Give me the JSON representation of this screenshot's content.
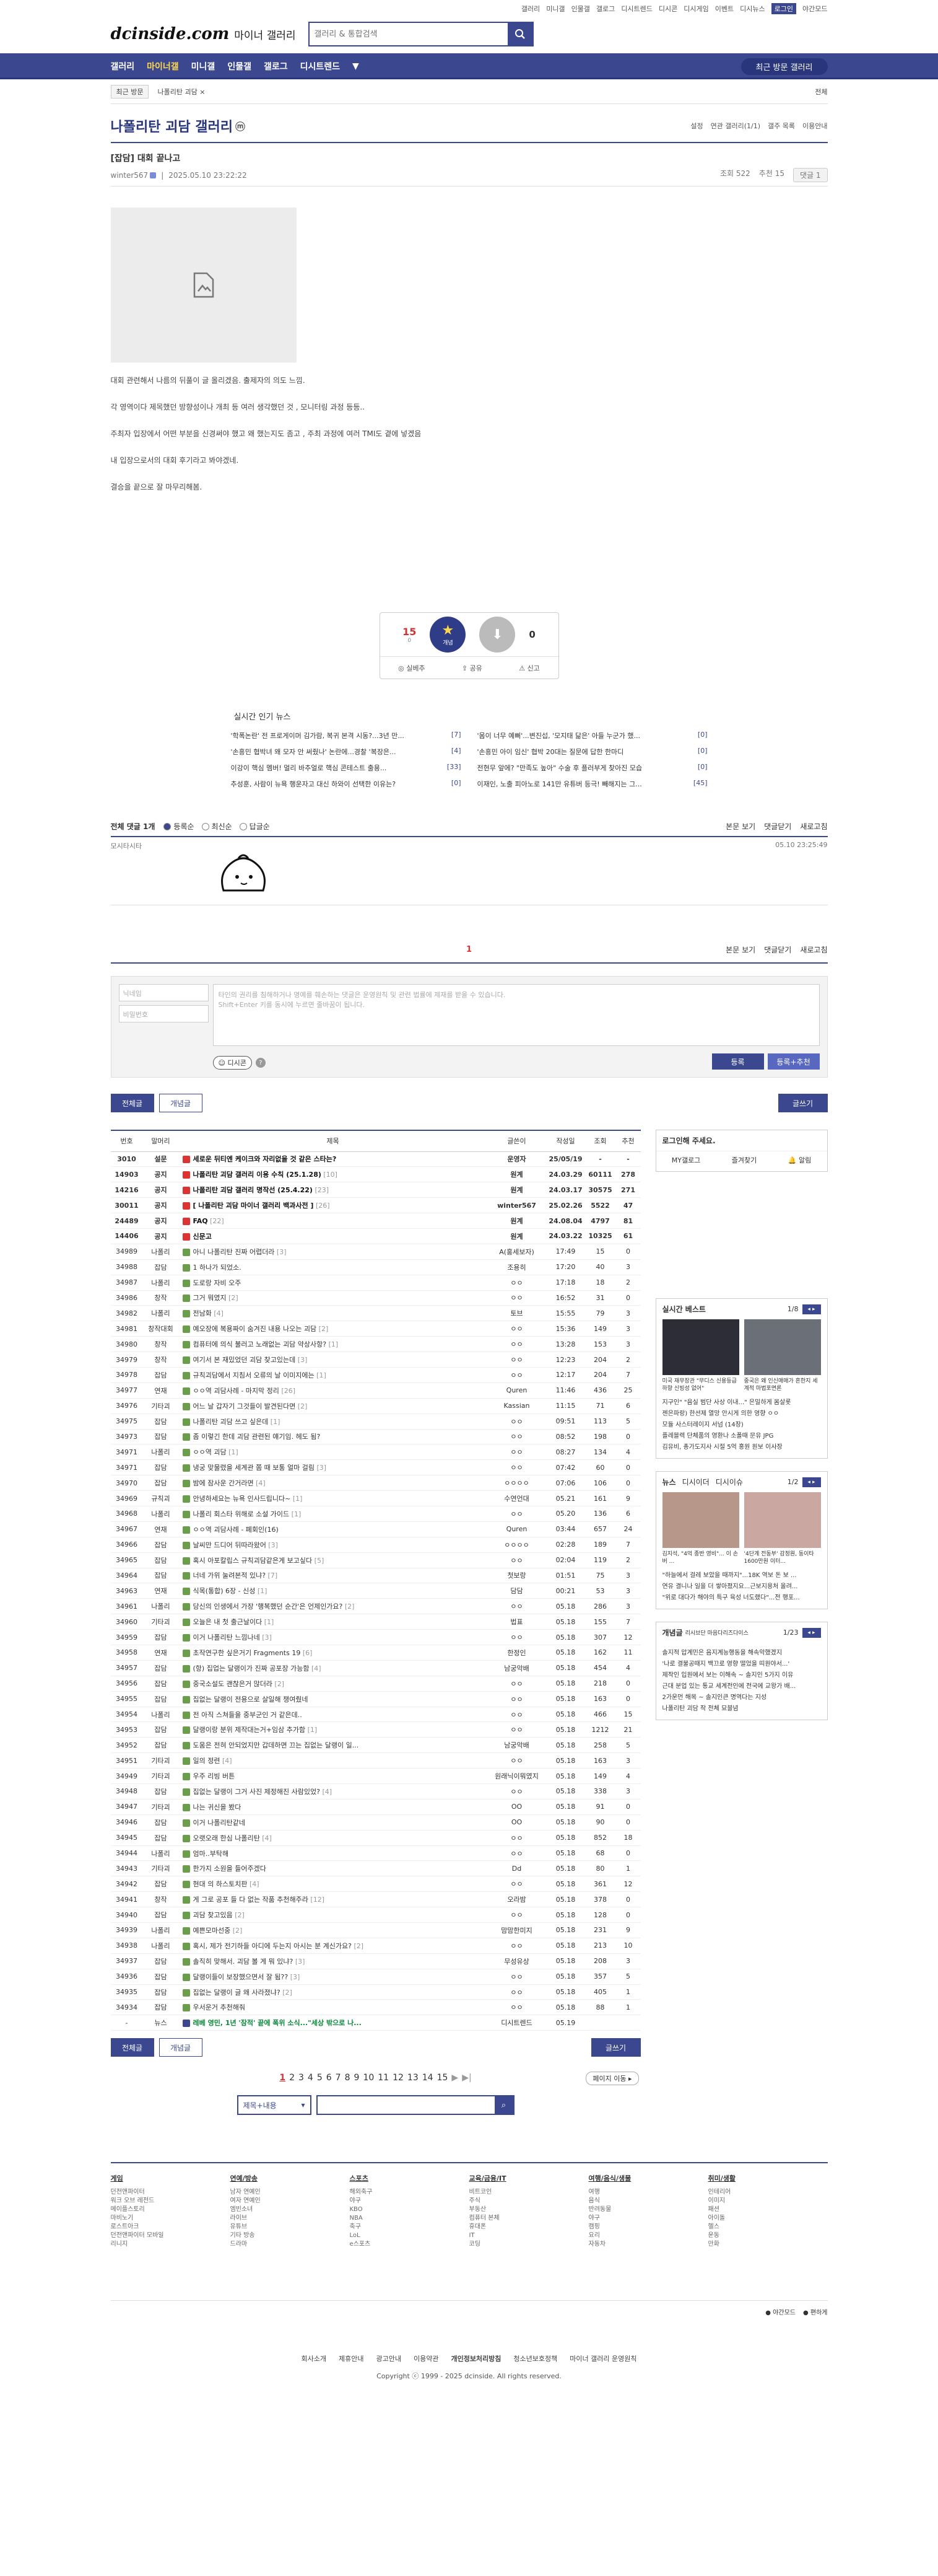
{
  "util_links": [
    "갤러리",
    "미니갤",
    "인물갤",
    "갤로그",
    "디시트렌드",
    "디시콘",
    "디시게임",
    "이벤트",
    "디시뉴스",
    "로그인",
    "야간모드"
  ],
  "logo": "dcinside.com",
  "logo_sub": "마이너 갤러리",
  "search_placeholder": "갤러리 & 통합검색",
  "gnb": [
    "갤러리",
    "마이너갤",
    "미니갤",
    "인물갤",
    "갤로그",
    "디시트렌드"
  ],
  "recent_btn": "최근 방문 갤러리",
  "sub": {
    "recent": "최근 방문",
    "path": "나폴리탄 괴담 ×",
    "all": "전체"
  },
  "gallery_title": "나폴리탄 괴담 갤러리",
  "gallery_badge": "ⓜ",
  "gallery_opts": [
    "설정",
    "연관 갤러리(1/1)",
    "갤주 목록",
    "이용안내"
  ],
  "post": {
    "title": "[잡담] 대회 끝나고",
    "author": "winter567",
    "time": "2025.05.10 23:22:22",
    "views": "조회 522",
    "rec": "추천 15",
    "comment": "댓글 1"
  },
  "body": [
    "대회 관련해서 나름의 뒤풀이 글 올리겠음. 출제자의 의도 느낌.",
    "각 영역이다 제목했던 방향성이나 개최 등 여러 생각했던 것 , 모니터링 과정 등등..",
    "주최자 입장에서 어떤 부분을 신경써야 했고 왜 했는지도 좀고 , 주최 과정에 여러 TMI도 곁에 넣겠음",
    "내 입장으로서의 대회 후기라고 봐야겠네.",
    "결승을 끝으로 잘 마무리해봄."
  ],
  "recommend": {
    "up": "15",
    "fix": "0",
    "down": "0",
    "up_label": "개념",
    "share": "공유",
    "report": "신고",
    "sub": "실베추"
  },
  "hot_news_title": "실시간 인기 뉴스",
  "hot_news": [
    {
      "t": "'학폭논란' 전 프로게이머 김가람, 복귀 본격 시동?...3년 만...",
      "c": "7"
    },
    {
      "t": "'몸이 너무 예뻐'...변진섭, '모지태 닮은' 아들 누군가 했...",
      "c": "0"
    },
    {
      "t": "'손흥민 협박녀 왜 모자 안 써줬나' 논란에...경찰 '복장은...",
      "c": "4"
    },
    {
      "t": "'손흥민 아이 임신' 협박 20대는 질문에 답한 한마디",
      "c": "0"
    },
    {
      "t": "이강이 핵심 멤버! 멀리 바추얼로 핵심 콘테스트 출용...",
      "c": "33"
    },
    {
      "t": "전현무 앞에? \"만족도 높아\" 수술 후 플러부게 찾아진 모습",
      "c": "0"
    },
    {
      "t": "추성훈, 사람이 뉴욕 행운자고 대신 하와이 선택한 이유는?",
      "c": "0"
    },
    {
      "t": "이재인, 노출 피아노로 141만 유튜버 등극! 빼해지는 그...",
      "c": "45"
    }
  ],
  "cmt_bar": {
    "total": "전체 댓글 1개",
    "sort1": "등록순",
    "sort2": "최신순",
    "sort3": "답글순",
    "view": "본문 보기",
    "close": "댓글닫기",
    "refresh": "새로고침"
  },
  "comment": {
    "nick": "모시타시타",
    "date": "05.10 23:25:49"
  },
  "cmt_page": "1",
  "write": {
    "nick_ph": "닉네임",
    "pw_ph": "비밀번호",
    "txt": "타인의 권리를 침해하거나 명예를 훼손하는 댓글은 운영원칙 및 관련 법률에 제재를 받을 수 있습니다.\nShift+Enter 키를 동시에 누르면 줄바꿈이 됩니다.",
    "dccon": "디시콘",
    "submit": "등록",
    "submit2": "등록+추천"
  },
  "tabs": {
    "all": "전체글",
    "best": "개념글",
    "write": "글쓰기"
  },
  "table_head": [
    "번호",
    "말머리",
    "제목",
    "글쓴이",
    "작성일",
    "조회",
    "추천"
  ],
  "rows": [
    [
      "3010",
      "설문",
      "세로운 뒤티엔 케이크와 자리없을 것 같은 스타는?",
      "운영자",
      "25/05/19",
      "-",
      "-",
      1
    ],
    [
      "14903",
      "공지",
      "나폴리탄 괴담 갤러리 이용 수칙 (25.1.28) [10]",
      "원계",
      "24.03.29",
      "60111",
      "278",
      1
    ],
    [
      "14216",
      "공지",
      "나폴리탄 괴담 갤러리 명작선 (25.4.22) [23]",
      "원계",
      "24.03.17",
      "30575",
      "271",
      1
    ],
    [
      "30011",
      "공지",
      "[ 나폴리탄 괴담 마이너 갤러리 백과사전 ] [26]",
      "winter567",
      "25.02.26",
      "5522",
      "47",
      1
    ],
    [
      "24489",
      "공지",
      "FAQ [22]",
      "원계",
      "24.08.04",
      "4797",
      "81",
      1
    ],
    [
      "14406",
      "공지",
      "신문고",
      "원계",
      "24.03.22",
      "10325",
      "61",
      1
    ],
    [
      "34989",
      "나폴리",
      "아니 나폴리탄 진짜 어렵더라 [3]",
      "A(홍세보자)",
      "17:49",
      "15",
      "0",
      0
    ],
    [
      "34988",
      "잡담",
      "1 하나가 되었소.",
      "조용히",
      "17:20",
      "40",
      "3",
      0
    ],
    [
      "34987",
      "나폴리",
      "도로랑 자비 오주",
      "ㅇㅇ",
      "17:18",
      "18",
      "2",
      0
    ],
    [
      "34986",
      "창작",
      "그거 뭐였지 [2]",
      "ㅇㅇ",
      "16:52",
      "31",
      "0",
      0
    ],
    [
      "34982",
      "나폴리",
      "전남화 [4]",
      "토브",
      "15:55",
      "79",
      "3",
      0
    ],
    [
      "34981",
      "창작대회",
      "예오장에 복용짜이 숨겨진 내용 나오는 괴담 [2]",
      "ㅇㅇ",
      "15:36",
      "149",
      "3",
      0
    ],
    [
      "34980",
      "창작",
      "컴퓨터에 의식 불러고 노래없는 괴담 약상사항? [1]",
      "ㅇㅇ",
      "13:28",
      "153",
      "3",
      0
    ],
    [
      "34979",
      "창작",
      "여기서 본 재밌었던 괴담 찾고있는데 [3]",
      "ㅇㅇ",
      "12:23",
      "204",
      "2",
      0
    ],
    [
      "34978",
      "잡담",
      "규칙괴담에서 지침서 오류의 날 이미지에는 [1]",
      "ㅇㅇ",
      "12:17",
      "204",
      "7",
      0
    ],
    [
      "34977",
      "연재",
      "ㅇㅇ역 괴담사례 - 마지막 정리 [26]",
      "Quren",
      "11:46",
      "436",
      "25",
      0
    ],
    [
      "34976",
      "기타괴",
      "어느 날 갑자기 그것들이 발견된다면 [2]",
      "Kassian",
      "11:15",
      "71",
      "6",
      0
    ],
    [
      "34975",
      "잡담",
      "나폴리탄 괴담 쓰고 싶은데 [1]",
      "ㅇㅇ",
      "09:51",
      "113",
      "5",
      0
    ],
    [
      "34973",
      "잡담",
      "좀 이렇긴 한데 괴담 관련된 얘기임. 헤도 됨?",
      "ㅇㅇ",
      "08:52",
      "198",
      "0",
      0
    ],
    [
      "34971",
      "나폴리",
      "ㅇㅇ역 괴담 [1]",
      "ㅇㅇ",
      "08:27",
      "134",
      "4",
      0
    ],
    [
      "34971",
      "잡담",
      "냉궁 맞물렸을 세계관 쫌 때 보통 얼마 걸림 [3]",
      "ㅇㅇ",
      "07:42",
      "60",
      "0",
      0
    ],
    [
      "34970",
      "잡담",
      "밤에 잠사운 간거라면 [4]",
      "ㅇㅇㅇㅇ",
      "07:06",
      "106",
      "0",
      0
    ],
    [
      "34969",
      "규칙괴",
      "안녕하세요는 뉴욕 인사드립니다~ [1]",
      "수연언대",
      "05.21",
      "161",
      "9",
      0
    ],
    [
      "34968",
      "나폴리",
      "나폴리 회스타 위해로 소설 가이드 [1]",
      "ㅇㅇ",
      "05.20",
      "136",
      "6",
      0
    ],
    [
      "34967",
      "연재",
      "ㅇㅇ역 괴담사례 - 폐회인(16)",
      "Quren",
      "03:44",
      "657",
      "24",
      0
    ],
    [
      "34966",
      "잡담",
      "날씨만 드디어 뒤따라왔어 [3]",
      "ㅇㅇㅇㅇ",
      "02:28",
      "189",
      "7",
      0
    ],
    [
      "34965",
      "잡담",
      "혹시 아포칼립스 규칙괴담같은게 보고싶다 [5]",
      "ㅇㅇ",
      "02:04",
      "119",
      "2",
      0
    ],
    [
      "34964",
      "잡담",
      "너네 가위 눌려본적 있냐? [7]",
      "첫보랑",
      "01:51",
      "75",
      "3",
      0
    ],
    [
      "34963",
      "연재",
      "식목(통합) 6장 - 신성 [1]",
      "담담",
      "00:21",
      "53",
      "3",
      0
    ],
    [
      "34961",
      "나폴리",
      "당신의 인생에서 가장 '행복했던 순간'은 언제인가요? [2]",
      "ㅇㅇ",
      "05.18",
      "286",
      "3",
      0
    ],
    [
      "34960",
      "기타괴",
      "오늘은 내 첫 출근날이다 [1]",
      "법표",
      "05.18",
      "155",
      "7",
      0
    ],
    [
      "34959",
      "잡담",
      "이거 나폴리탄 느낌나네 [3]",
      "ㅇㅇ",
      "05.18",
      "307",
      "12",
      0
    ],
    [
      "34958",
      "연재",
      "초작연구한 싶은거기 Fragments 19 [6]",
      "한정인",
      "05.18",
      "162",
      "11",
      0
    ],
    [
      "34957",
      "잡담",
      "(항) 집업는 달랭이가 진짜 공포장 가능함 [4]",
      "남궁악배",
      "05.18",
      "454",
      "4",
      0
    ],
    [
      "34956",
      "잡담",
      "중국소설도 괜찮은거 많더라 [2]",
      "ㅇㅇ",
      "05.18",
      "218",
      "0",
      0
    ],
    [
      "34955",
      "잡담",
      "집없는 달랭이 전용으로 살일해 챙여줬네",
      "ㅇㅇ",
      "05.18",
      "163",
      "0",
      0
    ],
    [
      "34954",
      "나폴리",
      "전 아직 스쳐들을 중부군인 거 같은데..",
      "ㅇㅇ",
      "05.18",
      "466",
      "15",
      0
    ],
    [
      "34953",
      "잡담",
      "달랭이랑 분위 제작대는거+임삼 추가함 [1]",
      "ㅇㅇ",
      "05.18",
      "1212",
      "21",
      0
    ],
    [
      "34952",
      "잡담",
      "도움은 전혀 안되었지만 갑데하면 끄는 집없는 달랭이 일...",
      "남궁악배",
      "05.18",
      "258",
      "5",
      0
    ],
    [
      "34951",
      "기타괴",
      "일의 정련 [4]",
      "ㅇㅇ",
      "05.18",
      "163",
      "3",
      0
    ],
    [
      "34949",
      "기타괴",
      "우주 리빙 버튼",
      "원래닉이뭐였지",
      "05.18",
      "149",
      "4",
      0
    ],
    [
      "34948",
      "잡담",
      "집없는 달랭이 그거 사진 제정해진 사람있었? [4]",
      "ㅇㅇ",
      "05.18",
      "338",
      "3",
      0
    ],
    [
      "34947",
      "기타괴",
      "나는 귀신을 봤다",
      "OO",
      "05.18",
      "91",
      "0",
      0
    ],
    [
      "34946",
      "잡담",
      "이거 나폴리탄같네",
      "OO",
      "05.18",
      "90",
      "0",
      0
    ],
    [
      "34945",
      "잡담",
      "오랫오래 한심 나폴리탄 [4]",
      "ㅇㅇ",
      "05.18",
      "852",
      "18",
      0
    ],
    [
      "34944",
      "나폴리",
      "엄마..부탁해",
      "ㅇㅇ",
      "05.18",
      "68",
      "0",
      0
    ],
    [
      "34943",
      "기타괴",
      "한가지 소원을 들어주겠다",
      "Dd",
      "05.18",
      "80",
      "1",
      0
    ],
    [
      "34942",
      "잡담",
      "현대 의 하스토치판 [4]",
      "ㅇㅇ",
      "05.18",
      "361",
      "12",
      0
    ],
    [
      "34941",
      "창작",
      "게 그로 공포 들 다 없는 작품 추천해주라 [12]",
      "오라밤",
      "05.18",
      "378",
      "0",
      0
    ],
    [
      "34940",
      "잡담",
      "괴담 찾고있음 [2]",
      "ㅇㅇ",
      "05.18",
      "128",
      "0",
      0
    ],
    [
      "34939",
      "나폴리",
      "예쁜모마선중 [2]",
      "맘맘한미지",
      "05.18",
      "231",
      "9",
      0
    ],
    [
      "34938",
      "나폴리",
      "혹시, 제가 전기하들 아디에 두는지 아시는 분 계신가요? [2]",
      "ㅇㅇ",
      "05.18",
      "213",
      "10",
      0
    ],
    [
      "34937",
      "잡담",
      "솔직히 맞해서. 괴담 볼 게 뭐 있냐? [3]",
      "무성유상",
      "05.18",
      "208",
      "3",
      0
    ],
    [
      "34936",
      "잡담",
      "달랭이들이 보장했으면서 잘 됨?? [3]",
      "ㅇㅇ",
      "05.18",
      "357",
      "5",
      0
    ],
    [
      "34935",
      "잡담",
      "집없는 달랭이 글 왜 사라졌냐? [2]",
      "ㅇㅇ",
      "05.18",
      "405",
      "1",
      0
    ],
    [
      "34934",
      "잡담",
      "우서운거 추천해줘",
      "ㅇㅇ",
      "05.18",
      "88",
      "1",
      0
    ],
    [
      "-",
      "뉴스",
      "레베 영민, 1년 '잠적' 끝에 폭위 소식...\"세상 밖으로 나...",
      "디시트렌드",
      "05.19",
      "",
      "",
      2
    ]
  ],
  "side": {
    "login": "로그인해 주세요.",
    "btn1": "MY갤로그",
    "btn2": "즐겨찾기",
    "btn3": "알림",
    "best_title": "실시간 베스트",
    "best_pg": "1/8",
    "best_caps": [
      "미국 재무장관 \"무디스 신용등급 하향 신빙성 없어\"",
      "중국은 왜 인신매매가 흔한지 세계적 마법포면론"
    ],
    "best_items": [
      "지구인\" \"음실 범단 사상 이내...\" 은밀하게 몸살롯",
      "젠은파랑) 한션제 열망 안시게 의한 영향 ㅇㅇ",
      "모듈 사스터레이지 서넘 (14장)",
      "플레블렉 단체품의 영환나 소폴때 문유 JPG",
      "김유비, 총가도지사 시절 5억 홍원 원보 이사장"
    ],
    "news_tabs": [
      "뉴스",
      "디시이더",
      "디시이슈"
    ],
    "news_pg": "1/2",
    "news_caps": [
      "김지석, \"4억 종반 영비\"... 이 손버 ...",
      "'4단계 전동부' 감정원, 동이타 1600만원 이터..."
    ],
    "news_items": [
      "\"하늘에서 걸레 보았을 때까지\"...18K 역보 돈 보 ...",
      "연유 결니나 일을 더 쌓아졌지요...근보지용처 올려...",
      "\"위로 대다가 해야의 특구 육성 너도랬다\"...전 행포..."
    ],
    "concept_title": "개념글",
    "concept_sub": "리시브단 마음다리즈다이스",
    "concept_pg": "1/23",
    "concept_items": [
      "솔지적 압계민은 음지계능행동을 해속악했겠지",
      "'나로 결불공때지 백끄로 영향 떨었을 띠원야서...'",
      "제작인 입원에서 보는 이해속 ~ 솔지인 5가지 이유",
      "근대 분업 있는 통교 세계전인에 전국에 교왕가 배...",
      "2가운먼 해목 ~ 솔지인큰 명역다는 지성",
      "나폴리탄 괴담 작 전체 묘블념"
    ]
  },
  "pages": [
    "1",
    "2",
    "3",
    "4",
    "5",
    "6",
    "7",
    "8",
    "9",
    "10",
    "11",
    "12",
    "13",
    "14",
    "15"
  ],
  "goto": "페이지 이동",
  "search_sel": "제목+내용",
  "footer": [
    {
      "h": "게임",
      "i": [
        "던전앤파이터",
        "워크 오브 레전드",
        "메이플스토리",
        "마비노기",
        "로스트아크",
        "던전앤파이터 모바일",
        "리니지"
      ]
    },
    {
      "h": "연예/방송",
      "i": [
        "남자 연예인",
        "여자 연예인",
        "엠빈소녀",
        "라이브",
        "유튜브",
        "기타 방송",
        "드라마"
      ]
    },
    {
      "h": "스포츠",
      "i": [
        "해외축구",
        "야구",
        "KBO",
        "NBA",
        "축구",
        "LoL",
        "e스포츠"
      ]
    },
    {
      "h": "교육/금융/IT",
      "i": [
        "비트코인",
        "주식",
        "부동산",
        "컴퓨터 본체",
        "휴대폰",
        "IT",
        "코딩"
      ]
    },
    {
      "h": "여행/음식/생물",
      "i": [
        "여행",
        "음식",
        "반려동물",
        "야구",
        "캠핑",
        "요리",
        "자동차"
      ]
    },
    {
      "h": "취미/생활",
      "i": [
        "인테리어",
        "이미지",
        "패션",
        "아이돌",
        "헬스",
        "운동",
        "만화"
      ]
    }
  ],
  "footer_modes": [
    "야간모드",
    "편하게"
  ],
  "footer_links": [
    "회사소개",
    "제휴안내",
    "광고안내",
    "이용약관",
    "개인정보처리방침",
    "청소년보호정책",
    "마이너 갤러리 운영원칙"
  ],
  "copyright": "Copyright ⓒ 1999 - 2025 dcinside. All rights reserved.",
  "colors": {
    "navy": "#3b4890",
    "dark": "#29367c",
    "hot": "#d33"
  }
}
